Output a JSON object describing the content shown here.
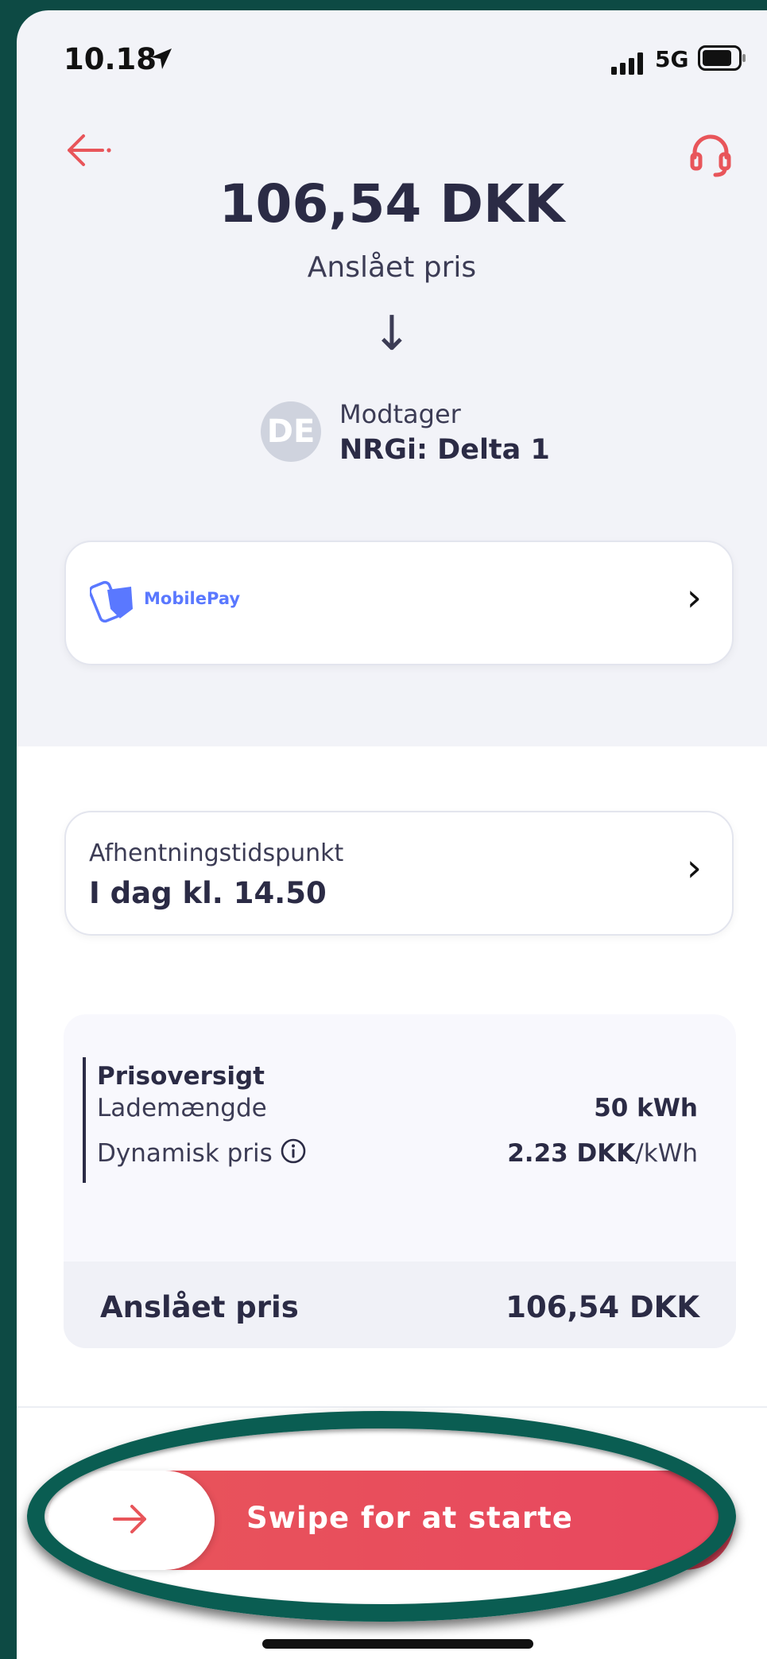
{
  "status_bar": {
    "time": "10.18",
    "network": "5G"
  },
  "header": {
    "back_icon": "arrow-left-icon",
    "support_icon": "headset-icon",
    "amount": "106,54 DKK",
    "amount_caption": "Anslået pris",
    "arrow_glyph": "↓"
  },
  "recipient": {
    "avatar_initials": "DE",
    "label": "Modtager",
    "name": "NRGi: Delta 1"
  },
  "payment_method": {
    "label": "MobilePay",
    "chevron": "›"
  },
  "pickup": {
    "label": "Afhentningstidspunkt",
    "value": "I dag kl. 14.50",
    "chevron": "›"
  },
  "price_overview": {
    "title": "Prisoversigt",
    "rows": [
      {
        "label": "Lademængde",
        "value_bold": "50 kWh",
        "value_unit": ""
      },
      {
        "label": "Dynamisk pris",
        "value_bold": "2.23 DKK",
        "value_unit": "/kWh"
      }
    ],
    "total_label": "Anslået pris",
    "total_value": "106,54 DKK"
  },
  "swipe": {
    "label": "Swipe for at starte",
    "accent_color": "#e8555a"
  },
  "colors": {
    "accent": "#e8555a",
    "text_dark": "#2b2b45",
    "annotation_ring": "#0a5d52"
  }
}
